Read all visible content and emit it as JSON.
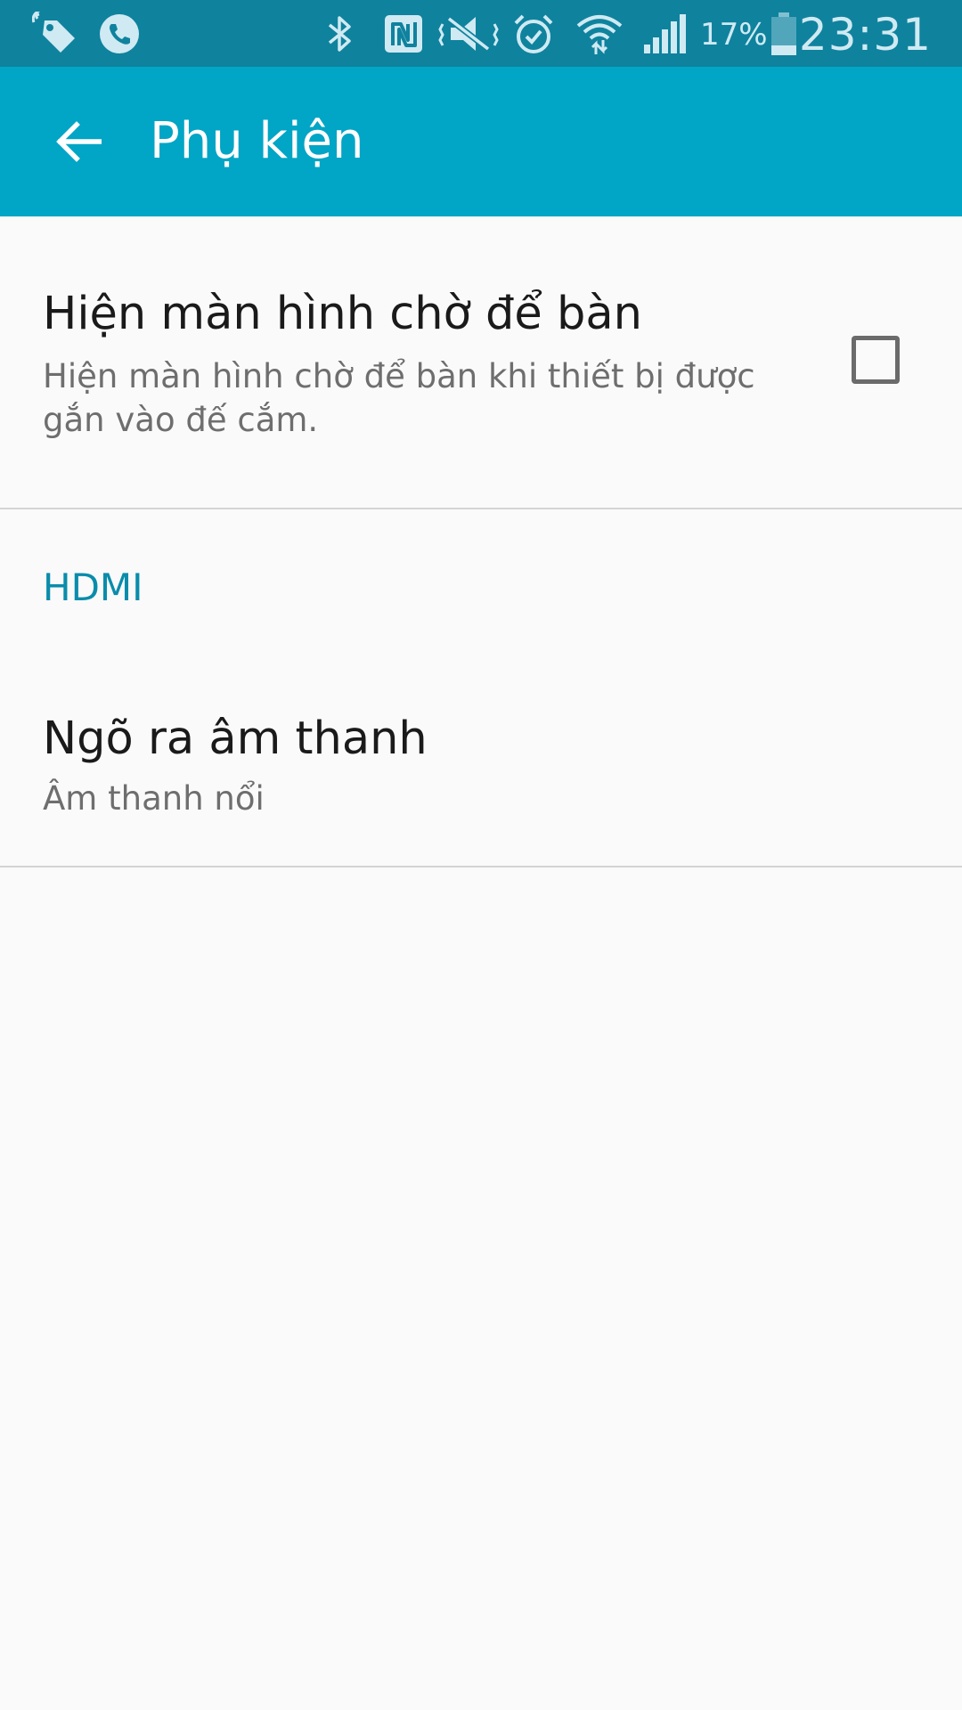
{
  "status_bar": {
    "battery_percent": "17%",
    "time": "23:31",
    "icons": [
      "tag-notification-icon",
      "phone-call-icon",
      "bluetooth-icon",
      "nfc-icon",
      "vibrate-mute-icon",
      "alarm-icon",
      "wifi-icon",
      "cell-signal-icon",
      "battery-icon"
    ],
    "color": "#0f829e"
  },
  "app_bar": {
    "title": "Phụ kiện",
    "back_icon": "arrow-left-icon",
    "color": "#01a5c5"
  },
  "settings": {
    "desk_dock": {
      "title": "Hiện màn hình chờ để bàn",
      "summary": "Hiện màn hình chờ để bàn khi thiết bị được gắn vào đế cắm.",
      "checked": false
    },
    "hdmi_section": {
      "header": "HDMI",
      "color": "#0a8cab"
    },
    "audio_output": {
      "title": "Ngõ ra âm thanh",
      "summary": "Âm thanh nổi"
    }
  }
}
